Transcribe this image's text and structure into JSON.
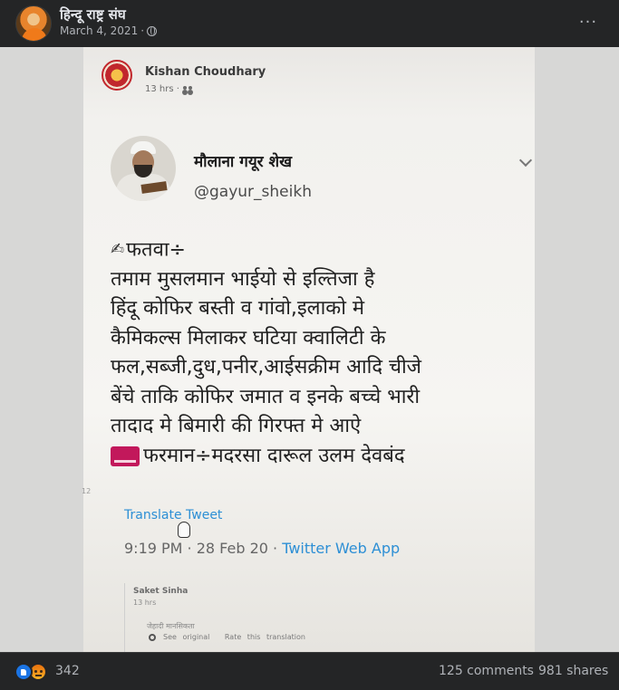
{
  "post": {
    "page_name": "हिन्दू राष्ट्र संघ",
    "date": "March 4, 2021",
    "more_label": "···",
    "privacy_icon": "globe-icon"
  },
  "image": {
    "fb_card": {
      "name": "Kishan Choudhary",
      "time": "13 hrs ·"
    },
    "tweet": {
      "name": "मौलाना गयूर शेख",
      "handle": "@gayur_sheikh",
      "lines": [
        "फतवा÷",
        "तमाम मुसलमान भाईयो से इल्तिजा है",
        "हिंदू कोफिर बस्ती व गांवो,इलाको मे",
        "कैमिकल्स मिलाकर घटिया क्वालिटी के",
        "फल,सब्जी,दुध,पनीर,आईसक्रीम आदि चीजे",
        "बेंचे ताकि कोफिर जमात व इनके बच्चे भारी",
        "तादाद मे बिमारी की गिरफ्त मे आऐ",
        "फरमान÷मदरसा दारूल उलम देवबंद"
      ],
      "translate_label": "Translate Tweet",
      "timestamp": "9:19 PM · 28 Feb 20 · ",
      "source": "Twitter Web App"
    },
    "reply": {
      "name": "Saket Sinha",
      "time": "13 hrs",
      "text": "जेहादी मानसिकता",
      "links": [
        "See original",
        "Rate this translation"
      ]
    },
    "side_mark": "12"
  },
  "footer": {
    "reaction_count": "342",
    "comments": "125 comments",
    "shares": "981 shares"
  },
  "colors": {
    "background": "#242526",
    "accent_blue": "#1b74e4",
    "link_blue": "#2d8fd5"
  }
}
